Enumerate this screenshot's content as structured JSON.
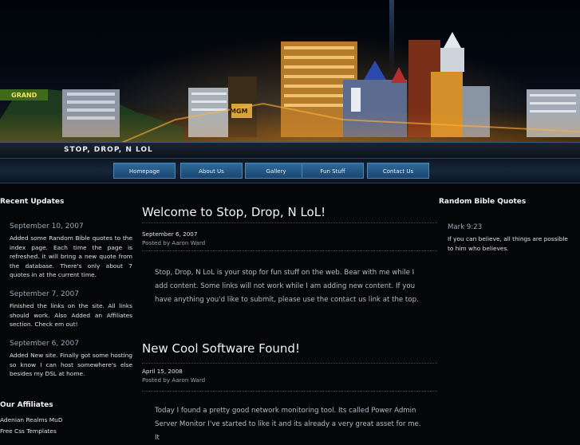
{
  "header": {
    "site_title": "STOP, DROP, N LOL",
    "banner_lights": [
      "GRAND",
      "MGM"
    ]
  },
  "nav": {
    "items": [
      "Homepage",
      "About Us",
      "Gallery",
      "Fun Stuff",
      "Contact Us"
    ]
  },
  "left": {
    "updates_heading": "Recent Updates",
    "updates": [
      {
        "date": "September 10, 2007",
        "text": "Added some Random Bible quotes to the index page. Each time the page is refreshed. it will bring a new quote from the database. There's only about 7 quotes in at the current time."
      },
      {
        "date": "September 7, 2007",
        "text": "Finished the links on the site. All links should work. Also Added an Affiliates section. Check em out!"
      },
      {
        "date": "September 6, 2007",
        "text": "Added New site. Finally got some hosting so know I can host somewhere's else besides my DSL at home."
      }
    ],
    "affiliates_heading": "Our Affiliates",
    "affiliates": [
      "Adenian Realms MuD",
      "Free Css Templates"
    ]
  },
  "main": {
    "posts": [
      {
        "title": "Welcome to Stop, Drop, N LoL!",
        "date": "September 6, 2007",
        "author": "Posted by Aaron Ward",
        "body": "Stop, Drop, N LoL is your stop for fun stuff on the web. Bear with me while I add content. Some links will not work while I am adding new content. If you have anything you'd like to submit, please use the contact us link at the top."
      },
      {
        "title": "New Cool Software Found!",
        "date": "April 15, 2008",
        "author": "Posted by Aaron Ward",
        "body": "Today I found a pretty good network monitoring tool. Its called Power Admin Server Monitor I've started to like it and its already a very great asset for me. It"
      }
    ]
  },
  "right": {
    "heading": "Random Bible Quotes",
    "ref": "Mark 9:23",
    "quote": "If you can believe, all things are possible to him who believes."
  },
  "colors": {
    "nav_button": "#2e6a9a",
    "background": "#050608",
    "accent_text": "#eef3f7"
  }
}
